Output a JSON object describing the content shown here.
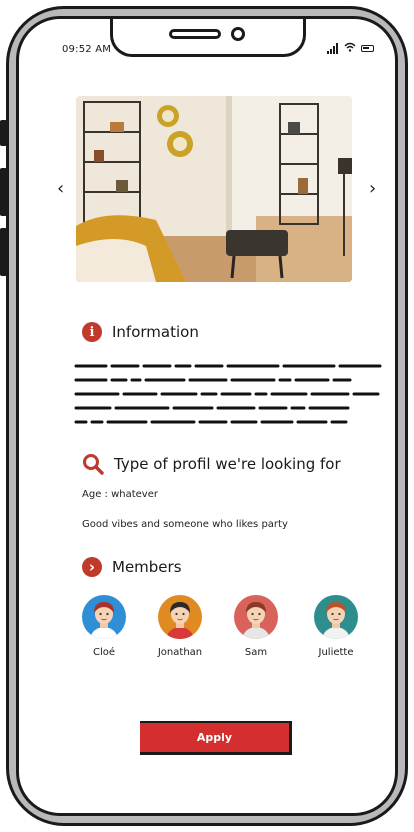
{
  "status_bar": {
    "time": "09:52 AM"
  },
  "carousel": {
    "prev_icon": "chevron-left-icon",
    "next_icon": "chevron-right-icon",
    "prev_glyph": "‹",
    "next_glyph": "›"
  },
  "information": {
    "icon": "info-icon",
    "icon_glyph": "i",
    "title": "Information"
  },
  "looking_for": {
    "icon": "search-icon",
    "title": "Type of profil we're looking for",
    "age_line": "Age : whatever",
    "description": "Good vibes and someone who likes party"
  },
  "members": {
    "icon": "chevron-right-circle-icon",
    "icon_glyph": "›",
    "title": "Members",
    "list": [
      {
        "name": "Cloé",
        "bg": "#2f8fd6",
        "hair": "#a8322a",
        "shirt": "#ffffff"
      },
      {
        "name": "Jonathan",
        "bg": "#e08a22",
        "hair": "#2a2a2a",
        "shirt": "#d83a3a"
      },
      {
        "name": "Sam",
        "bg": "#d9625a",
        "hair": "#8b3a26",
        "shirt": "#e6e6e6"
      },
      {
        "name": "Juliette",
        "bg": "#2e8d8d",
        "hair": "#b8552c",
        "shirt": "#f2f2f2"
      }
    ]
  },
  "apply_button": {
    "label": "Apply"
  },
  "colors": {
    "accent": "#d32f2f",
    "frame": "#b9b9b9"
  }
}
